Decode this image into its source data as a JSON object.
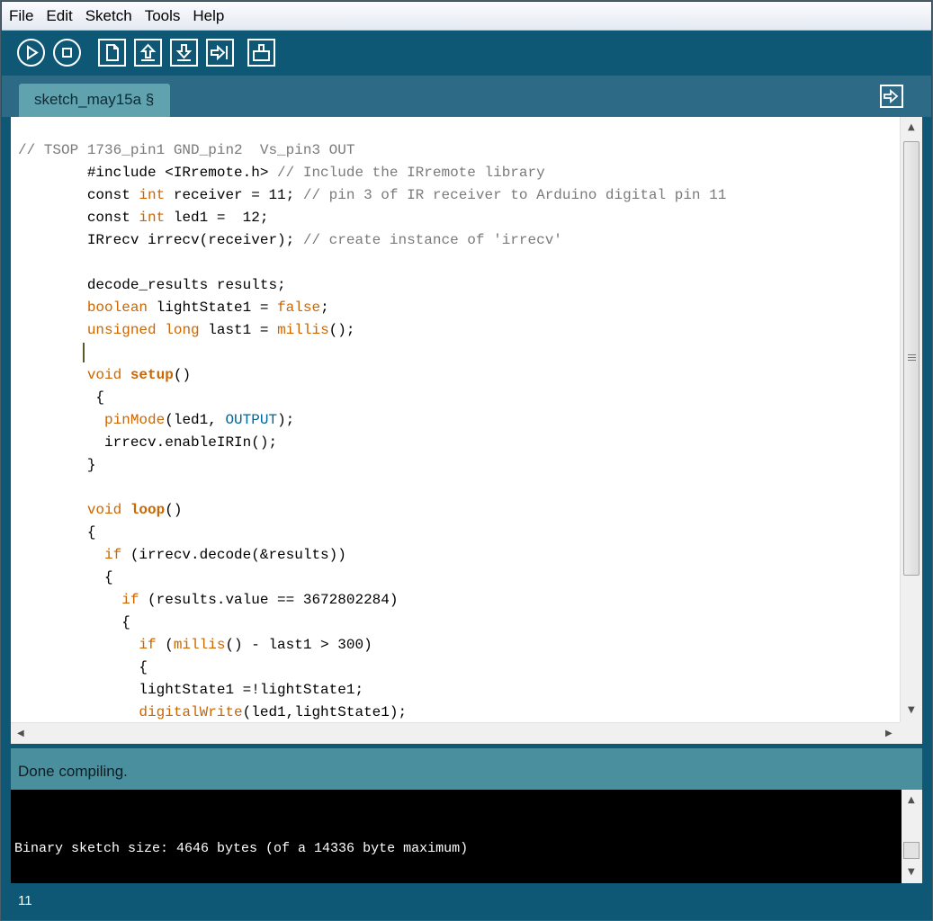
{
  "menu": [
    "File",
    "Edit",
    "Sketch",
    "Tools",
    "Help"
  ],
  "toolbar": {
    "buttons": [
      {
        "name": "verify-button",
        "icon": "play-icon"
      },
      {
        "name": "stop-button",
        "icon": "stop-icon"
      },
      {
        "name": "new-button",
        "icon": "new-document-icon"
      },
      {
        "name": "open-button",
        "icon": "upload-arrow-icon"
      },
      {
        "name": "save-button",
        "icon": "download-arrow-icon"
      },
      {
        "name": "upload-button",
        "icon": "export-arrow-icon"
      },
      {
        "name": "serial-monitor-button",
        "icon": "serial-monitor-icon"
      }
    ]
  },
  "tab": {
    "label": "sketch_may15a §"
  },
  "code_lines": [
    [
      [
        "// TSOP 1736_pin1 GND_pin2  Vs_pin3 OUT",
        "comment"
      ]
    ],
    [
      [
        "        #include <IRremote.h> ",
        ""
      ],
      [
        "// Include the IRremote library",
        "comment"
      ]
    ],
    [
      [
        "        const ",
        ""
      ],
      [
        "int",
        "kw"
      ],
      [
        " receiver = 11; ",
        ""
      ],
      [
        "// pin 3 of IR receiver to Arduino digital pin 11",
        "comment"
      ]
    ],
    [
      [
        "        const ",
        ""
      ],
      [
        "int",
        "kw"
      ],
      [
        " led1 =  12;",
        ""
      ]
    ],
    [
      [
        "        IRrecv irrecv(receiver); ",
        ""
      ],
      [
        "// create instance of 'irrecv'",
        "comment"
      ]
    ],
    [
      [
        "",
        ""
      ]
    ],
    [
      [
        "        decode_results results;",
        ""
      ]
    ],
    [
      [
        "        ",
        ""
      ],
      [
        "boolean",
        "kw"
      ],
      [
        " lightState1 = ",
        ""
      ],
      [
        "false",
        "kw"
      ],
      [
        ";",
        ""
      ]
    ],
    [
      [
        "        ",
        ""
      ],
      [
        "unsigned",
        "kw"
      ],
      [
        " ",
        ""
      ],
      [
        "long",
        "kw"
      ],
      [
        " last1 = ",
        ""
      ],
      [
        "millis",
        "kw"
      ],
      [
        "();",
        ""
      ]
    ],
    [
      [
        "",
        ""
      ]
    ],
    [
      [
        "        ",
        ""
      ],
      [
        "void",
        "kw"
      ],
      [
        " ",
        ""
      ],
      [
        "setup",
        "kwb"
      ],
      [
        "()",
        ""
      ]
    ],
    [
      [
        "         {",
        ""
      ]
    ],
    [
      [
        "          ",
        ""
      ],
      [
        "pinMode",
        "kw"
      ],
      [
        "(led1, ",
        ""
      ],
      [
        "OUTPUT",
        "const"
      ],
      [
        ");",
        ""
      ]
    ],
    [
      [
        "          irrecv.enableIRIn();",
        ""
      ]
    ],
    [
      [
        "        }",
        ""
      ]
    ],
    [
      [
        "",
        ""
      ]
    ],
    [
      [
        "        ",
        ""
      ],
      [
        "void",
        "kw"
      ],
      [
        " ",
        ""
      ],
      [
        "loop",
        "kwb"
      ],
      [
        "()",
        ""
      ]
    ],
    [
      [
        "        {",
        ""
      ]
    ],
    [
      [
        "          ",
        ""
      ],
      [
        "if",
        "kw"
      ],
      [
        " (irrecv.decode(&results))",
        ""
      ]
    ],
    [
      [
        "          {",
        ""
      ]
    ],
    [
      [
        "            ",
        ""
      ],
      [
        "if",
        "kw"
      ],
      [
        " (results.value == 3672802284)",
        ""
      ]
    ],
    [
      [
        "            {",
        ""
      ]
    ],
    [
      [
        "              ",
        ""
      ],
      [
        "if",
        "kw"
      ],
      [
        " (",
        ""
      ],
      [
        "millis",
        "kw"
      ],
      [
        "() - last1 > 300)",
        ""
      ]
    ],
    [
      [
        "              {",
        ""
      ]
    ],
    [
      [
        "              lightState1 =!lightState1;",
        ""
      ]
    ],
    [
      [
        "              ",
        ""
      ],
      [
        "digitalWrite",
        "kw"
      ],
      [
        "(led1,lightState1);",
        ""
      ]
    ]
  ],
  "status": {
    "message": "Done compiling."
  },
  "console": {
    "output": "Binary sketch size: 4646 bytes (of a 14336 byte maximum)"
  },
  "footer": {
    "line_number": "11"
  }
}
